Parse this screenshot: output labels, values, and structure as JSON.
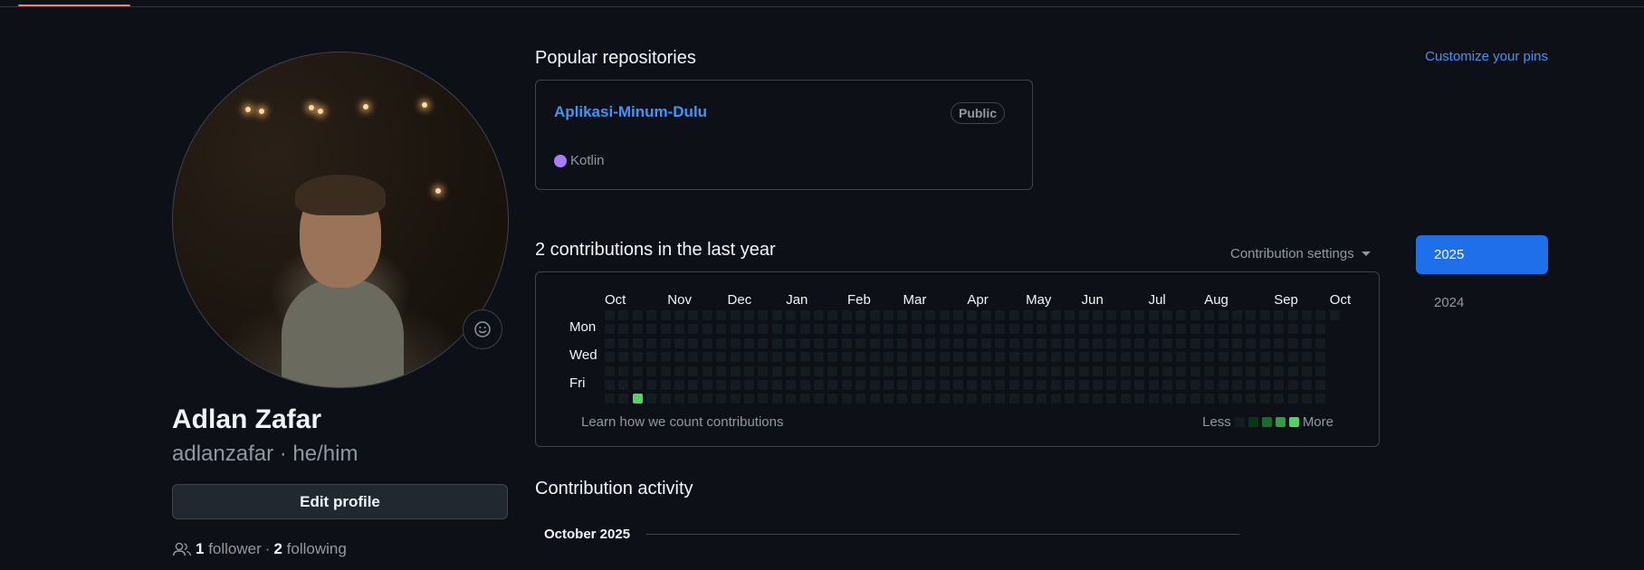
{
  "profile": {
    "name": "Adlan Zafar",
    "login_pronouns": "adlanzafar · he/him",
    "edit_button": "Edit profile",
    "followers_count": "1",
    "followers_label": "follower",
    "separator": "·",
    "following_count": "2",
    "following_label": "following"
  },
  "pinned": {
    "title": "Popular repositories",
    "customize_link": "Customize your pins",
    "repos": [
      {
        "name": "Aplikasi-Minum-Dulu",
        "visibility": "Public",
        "language": "Kotlin",
        "language_color": "#a97bff"
      }
    ]
  },
  "contributions": {
    "title": "2 contributions in the last year",
    "settings_label": "Contribution settings",
    "months": [
      "Oct",
      "Nov",
      "Dec",
      "Jan",
      "Feb",
      "Mar",
      "Apr",
      "May",
      "Jun",
      "Jul",
      "Aug",
      "Sep",
      "Oct"
    ],
    "day_labels": [
      "Mon",
      "Wed",
      "Fri"
    ],
    "learn_link": "Learn how we count contributions",
    "legend_less": "Less",
    "legend_more": "More",
    "legend_colors": [
      "#151b23",
      "#033a16",
      "#196c2e",
      "#2ea043",
      "#56d364"
    ],
    "active_cell": {
      "week": 2,
      "day": 6,
      "color": "#56d364"
    },
    "weeks": 53
  },
  "years": {
    "active": "2025",
    "other": "2024"
  },
  "activity": {
    "title": "Contribution activity",
    "month_label": "October 2025"
  }
}
